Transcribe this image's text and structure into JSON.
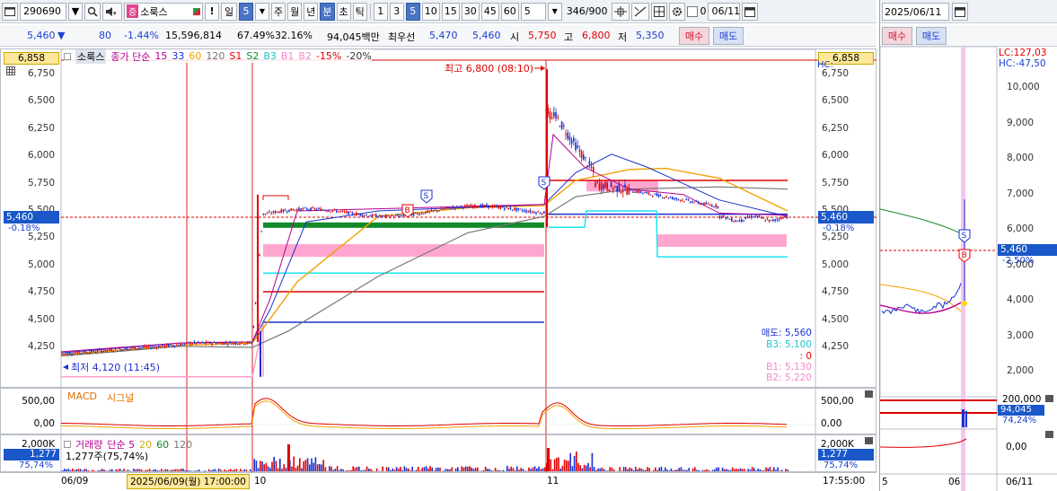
{
  "toolbar": {
    "code": "290690",
    "name_badge": "증",
    "name": "소룩스",
    "exclaim": "!",
    "period_label": "일",
    "period_value": "5",
    "btn_week": "주",
    "btn_month": "월",
    "btn_year": "년",
    "btn_min": "분",
    "btn_sec": "초",
    "btn_tick": "틱",
    "intervals": [
      "1",
      "3",
      "5",
      "10",
      "15",
      "30",
      "45",
      "60"
    ],
    "interval_active": "5",
    "interval_input": "5",
    "counter": "346/900",
    "chk_label": "0",
    "date": "06/11"
  },
  "quote": {
    "price": "5,460",
    "arrow": "▼",
    "change": "80",
    "change_pct": "-1.44%",
    "volume": "15,596,814",
    "vol_pct": "67.49%",
    "turnover_pct": "32.16%",
    "amount": "94,045백만",
    "best_label": "최우선",
    "best_ask": "5,470",
    "best_bid": "5,460",
    "open_label": "시",
    "open": "5,750",
    "high_label": "고",
    "high": "6,800",
    "low_label": "저",
    "low": "5,350",
    "buy_btn": "매수",
    "sell_btn": "매도"
  },
  "main_chart": {
    "legend": {
      "name": "소룩스",
      "ma_label": "종가 단순",
      "ma_periods": [
        "15",
        "33",
        "60",
        "120"
      ],
      "s1": "S1",
      "s2": "S2",
      "b3": "B3",
      "b1": "B1",
      "b2": "B2",
      "pct1": "-15%",
      "pct2": "-20%"
    },
    "colors": {
      "ma15": "#b7008f",
      "ma33": "#1a2fd0",
      "ma60": "#f2a100",
      "ma120": "#777777",
      "up": "#e00000",
      "down": "#1a2fd0",
      "pink": "#ff9ccb",
      "cyan": "#19e6ef",
      "green": "#118a2a"
    },
    "high_label": "최고 6,800 (08:10)",
    "low_label": "최저 4,120 (11:45)",
    "current_left": "5,460",
    "current_left_pct": "-0.18%",
    "current_right": "5,460",
    "current_right_pct": "-0.18%",
    "top_left_box": "6,858",
    "top_right_box": "6,858",
    "hc_label": "HC:",
    "y_ticks": [
      "6,750",
      "6,500",
      "6,250",
      "6,000",
      "5,750",
      "5,500",
      "5,250",
      "5,000",
      "4,750",
      "4,500",
      "4,250"
    ],
    "signals": {
      "sell": "매도: 5,560",
      "b3": "B3: 5,100",
      "zero": ": 0",
      "b1": "B1: 5,130",
      "b2": "B2: 5,220"
    }
  },
  "macd": {
    "title": "MACD",
    "signal": "시그널",
    "ticks": [
      "500,00",
      "0,00"
    ]
  },
  "volume": {
    "title": "거래량",
    "ma_label": "단순 5",
    "ma_periods": [
      "20",
      "60",
      "120"
    ],
    "current": "1,277주(75,74%)",
    "box_value": "1,277",
    "box_pct": "75,74%",
    "tick": "2,000K"
  },
  "x_axis": {
    "labels": [
      "06/09",
      "10",
      "11"
    ],
    "cursor": "2025/06/09(월) 17:00:00",
    "time": "17:55:00"
  },
  "side": {
    "date": "2025/06/11",
    "buy_btn": "매수",
    "sell_btn": "매도",
    "lc": "LC:127,03",
    "hc": "HC:-47,50",
    "y_ticks": [
      "10,000",
      "9,000",
      "8,000",
      "7,000",
      "6,000",
      "5,000",
      "4,000",
      "3,000",
      "2,000"
    ],
    "current": "5,460",
    "current_pct": "-2,50%",
    "vol_tick": "200,000",
    "vol_box": "94,045",
    "vol_pct": "74,24%",
    "macd_tick": "0,00",
    "x_labels": [
      "5",
      "06",
      "06/11"
    ]
  }
}
